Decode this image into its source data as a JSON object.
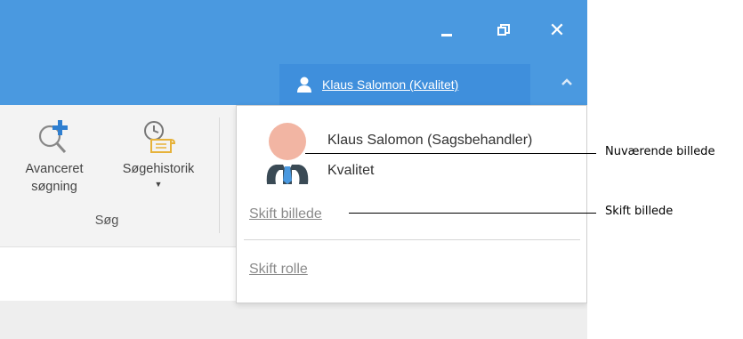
{
  "titlebar": {
    "minimize_label": "Minimize",
    "restore_label": "Restore",
    "close_glyph": "✕"
  },
  "user": {
    "display_name": "Klaus Salomon (Kvalitet)"
  },
  "ribbon": {
    "advanced_search_label": "Avanceret søgning",
    "search_history_label": "Søgehistorik",
    "search_history_arrow": "▼",
    "group_label": "Søg"
  },
  "dropdown": {
    "full_name": "Klaus Salomon (Sagsbehandler)",
    "role": "Kvalitet",
    "change_picture_label": "Skift billede",
    "change_role_label": "Skift rolle"
  },
  "callouts": {
    "current_picture": "Nuværende billede",
    "change_picture": "Skift billede"
  },
  "colors": {
    "titlebar": "#4a99e0",
    "user_chip": "#3f8fdc",
    "avatar_face": "#f2b5a3",
    "tie": "#4a99e0"
  }
}
